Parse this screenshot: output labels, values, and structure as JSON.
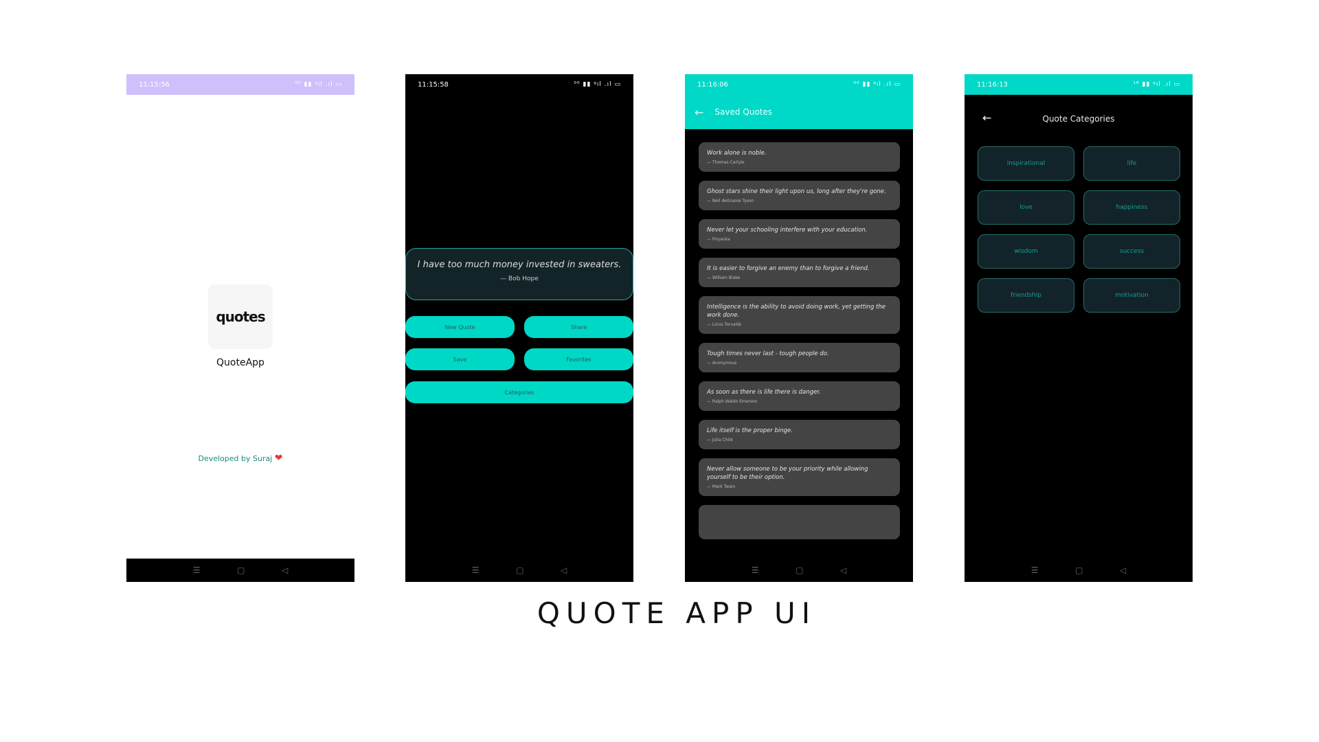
{
  "screens": [
    {
      "time": "11:15:56",
      "status_icons": "⁰⁰ ▮▮ ᵍıl .ıl ▭",
      "logo_text": "quotes",
      "app_name": "QuoteApp",
      "developer": "Developed by Suraj",
      "heart": "❤"
    },
    {
      "time": "11:15:58",
      "status_icons": "⁰⁰ ▮▮ ᵍıl .ıl ▭",
      "quote": "I have too much money invested in sweaters.",
      "author": "— Bob Hope",
      "buttons": {
        "new_quote": "New Quote",
        "share": "Share",
        "save": "Save",
        "favorites": "Favorites",
        "categories": "Categories"
      }
    },
    {
      "time": "11:16:06",
      "status_icons": "⁰⁰ ▮▮ ᵍıl .ıl ▭",
      "title": "Saved Quotes",
      "quotes": [
        {
          "text": "Work alone is noble.",
          "author": "— Thomas Carlyle"
        },
        {
          "text": "Ghost stars shine their light upon us, long after they're gone.",
          "author": "— Neil deGrasse Tyson"
        },
        {
          "text": "Never let your schooling interfere with your education.",
          "author": "— Priyanka"
        },
        {
          "text": "It is easier to forgive an enemy than to forgive a friend.",
          "author": "— William Blake"
        },
        {
          "text": "Intelligence is the ability to avoid doing work, yet getting the work done.",
          "author": "— Linus Torvalds"
        },
        {
          "text": "Tough times never last - tough people do.",
          "author": "— Anonymous"
        },
        {
          "text": "As soon as there is life there is danger.",
          "author": "— Ralph Waldo Emerson"
        },
        {
          "text": "Life itself is the proper binge.",
          "author": "— Julia Child"
        },
        {
          "text": "Never allow someone to be your priority while allowing yourself to be their option.",
          "author": "— Mark Twain"
        }
      ]
    },
    {
      "time": "11:16:13",
      "status_icons": "¹⁸ ▮▮ ᵍıl .ıl ▭",
      "title": "Quote Categories",
      "categories": [
        "inspirational",
        "life",
        "love",
        "happiness",
        "wisdom",
        "success",
        "friendship",
        "motivation"
      ]
    }
  ],
  "nav": {
    "menu": "☰",
    "home": "▢",
    "back": "◁"
  },
  "caption": "QUOTE APP UI",
  "colors": {
    "accent": "#00d8c8",
    "splash_status": "#cfc0fb",
    "card": "#444444",
    "category_text": "#1a9e92"
  }
}
